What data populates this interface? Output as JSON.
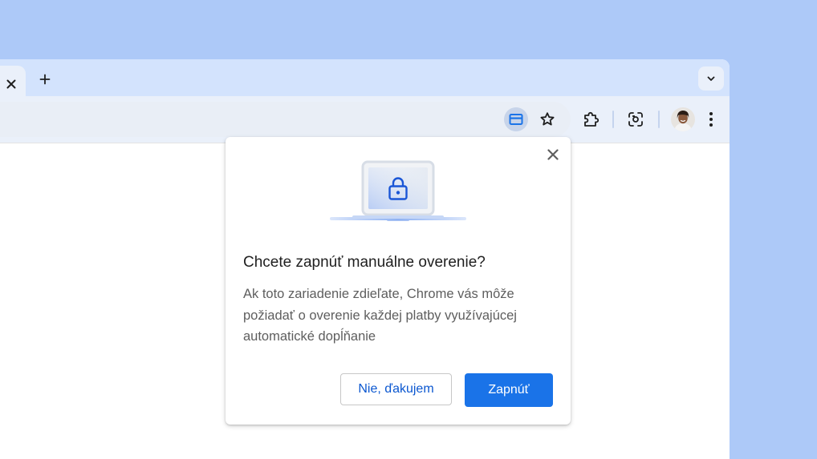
{
  "colors": {
    "desktop_background": "#adc9f8",
    "tabstrip": "#d3e3fd",
    "toolbar": "#eaf0fa",
    "primary_button": "#1a73e8",
    "link_blue": "#0b57d0",
    "icon": "#1f1f1f"
  },
  "tabstrip": {
    "active_tab_close_icon": "close-icon",
    "new_tab_icon": "plus-icon",
    "tab_search_icon": "chevron-down-icon"
  },
  "toolbar": {
    "omnibox_icons": [
      "credit-card-icon",
      "star-icon"
    ],
    "buttons": [
      "extensions-puzzle-icon",
      "google-lens-icon",
      "more-vert-icon"
    ],
    "avatar": "profile-avatar"
  },
  "dialog": {
    "title": "Chcete zapnúť manuálne overenie?",
    "body": "Ak toto zariadenie zdieľate, Chrome vás môže požiadať o overenie každej platby využívajúcej automatické dopĺňanie",
    "secondary_button": "Nie, ďakujem",
    "primary_button": "Zapnúť",
    "close_icon": "close-icon",
    "illustration": "laptop-lock-icon"
  }
}
